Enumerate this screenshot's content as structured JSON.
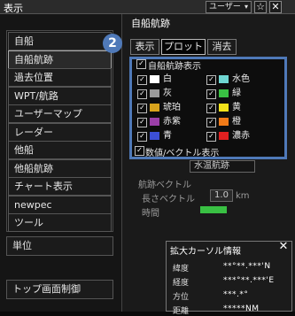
{
  "window": {
    "title": "表示"
  },
  "toolbar": {
    "user_label": "ユーザー",
    "chevron": "▾",
    "star": "☆",
    "close": "✕"
  },
  "menu": {
    "items": [
      {
        "label": "自船",
        "selected": false
      },
      {
        "label": "自船航跡",
        "selected": true
      },
      {
        "label": "過去位置",
        "selected": false
      },
      {
        "label": "WPT/航路",
        "selected": false
      },
      {
        "label": "ユーザーマップ",
        "selected": false
      },
      {
        "label": "レーダー",
        "selected": false
      },
      {
        "label": "他船",
        "selected": false
      },
      {
        "label": "他船航跡",
        "selected": false
      },
      {
        "label": "チャート表示",
        "selected": false
      },
      {
        "label": "newpec",
        "selected": false
      },
      {
        "label": "ツール",
        "selected": false
      }
    ],
    "unit_label": "単位",
    "top_screen_label": "トップ画面制御"
  },
  "panel": {
    "title": "自船航跡",
    "tabs": [
      {
        "label": "表示",
        "active": false
      },
      {
        "label": "プロット",
        "active": true
      },
      {
        "label": "消去",
        "active": false
      }
    ],
    "badge": "2",
    "header_check_label": "自船航跡表示",
    "colors": [
      {
        "label": "白",
        "hex": "#ffffff",
        "checked": true
      },
      {
        "label": "水色",
        "hex": "#6fd6d2",
        "checked": true
      },
      {
        "label": "灰",
        "hex": "#9a9a9a",
        "checked": true
      },
      {
        "label": "緑",
        "hex": "#39c043",
        "checked": true
      },
      {
        "label": "琥珀",
        "hex": "#d8a31c",
        "checked": true
      },
      {
        "label": "黄",
        "hex": "#f2e21a",
        "checked": true
      },
      {
        "label": "赤紫",
        "hex": "#9b3fa8",
        "checked": true
      },
      {
        "label": "橙",
        "hex": "#f07a18",
        "checked": true
      },
      {
        "label": "青",
        "hex": "#3c4fd6",
        "checked": true
      },
      {
        "label": "濃赤",
        "hex": "#e02020",
        "checked": true
      }
    ],
    "bottom_check_label": "数値/ベクトル表示",
    "under_select": "水温航跡",
    "under_section": "航跡ベクトル",
    "under_length_label": "長さベクトル",
    "under_length_value": "1.0",
    "under_length_unit": "km",
    "under_period_label": "時間"
  },
  "cursor_popup": {
    "title": "拡大カーソル情報",
    "close": "✕",
    "rows": [
      {
        "label": "緯度",
        "value": "**°**.***'N"
      },
      {
        "label": "経度",
        "value": "***°**.***'E"
      },
      {
        "label": "方位",
        "value": "***.*°"
      },
      {
        "label": "距離",
        "value": "*****NM"
      }
    ]
  }
}
